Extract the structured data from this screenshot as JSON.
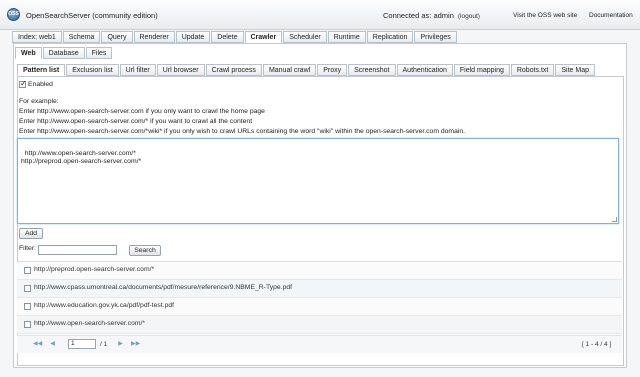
{
  "header": {
    "logo_text": "OSS",
    "app_title": "OpenSearchServer (community edition)",
    "connected_as": "Connected as: admin",
    "logout": "(logout)",
    "visit_site": "Visit the OSS web site",
    "documentation": "Documentation"
  },
  "main_tabs": [
    "Index: web1",
    "Schema",
    "Query",
    "Renderer",
    "Update",
    "Delete",
    "Crawler",
    "Scheduler",
    "Runtime",
    "Replication",
    "Privileges"
  ],
  "main_tab_active": "Crawler",
  "crawler_tabs": [
    "Web",
    "Database",
    "Files"
  ],
  "crawler_tab_active": "Web",
  "web_tabs": [
    "Pattern list",
    "Exclusion list",
    "Url filter",
    "Url browser",
    "Crawl process",
    "Manual crawl",
    "Proxy",
    "Screenshot",
    "Authentication",
    "Field mapping",
    "Robots.txt",
    "Site Map"
  ],
  "web_tab_active": "Pattern list",
  "enabled_label": "Enabled",
  "enabled_checked": true,
  "examples": {
    "heading": "For example:",
    "line1": "Enter http://www.open-search-server.com if you only want to crawl the home page",
    "line2": "Enter http://www.open-search-server.com/* if you want to crawl all the content",
    "line3": "Enter http://www.open-search-server.com/*wiki* if you only wish to crawl URLs containing the word \"wiki\" within the open-search-server.com domain."
  },
  "pattern_textarea": "http://www.open-search-server.com/*\nhttp://preprod.open-search-server.com/*",
  "add_button": "Add",
  "filter_label": "Filter:",
  "filter_value": "",
  "search_button": "Search",
  "patterns": [
    "http://preprod.open-search-server.com/*",
    "http://www.cpass.umontreal.ca/documents/pdf/mesure/reference/9.NBME_R-Type.pdf",
    "http://www.education.gov.yk.ca/pdf/pdf-test.pdf",
    "http://www.open-search-server.com/*"
  ],
  "pager": {
    "page": "1",
    "of_pages": "/ 1",
    "range": "[ 1 - 4 / 4 ]"
  },
  "colors": {
    "accent_border": "#7fb2d8",
    "pager_icon": "#7a9cc6"
  }
}
